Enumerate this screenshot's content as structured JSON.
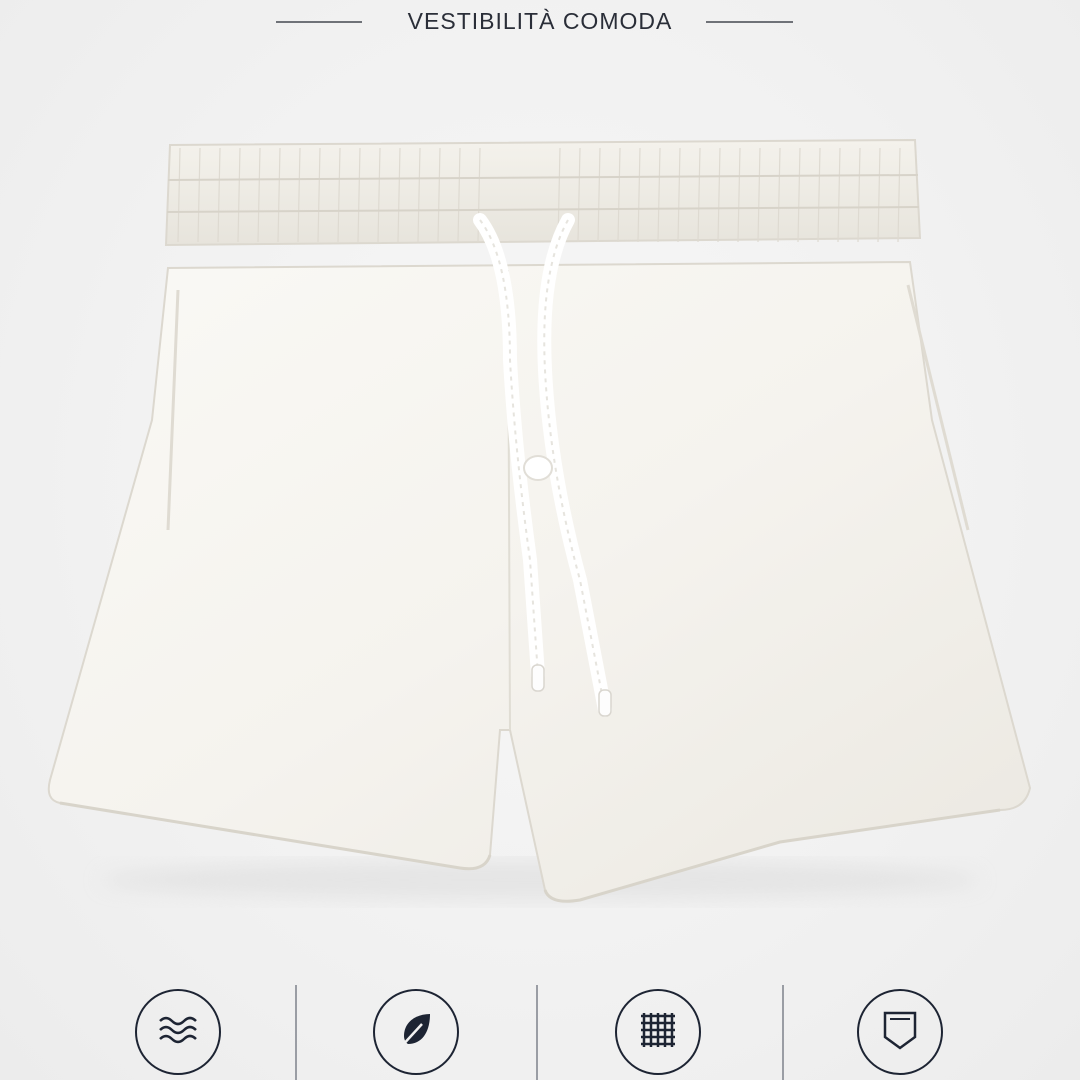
{
  "header": {
    "title": "VESTIBILITÀ COMODA"
  },
  "product": {
    "name": "white-swim-shorts",
    "color": "#f7f5f0"
  },
  "features": [
    {
      "icon": "waves-icon"
    },
    {
      "icon": "leaf-icon"
    },
    {
      "icon": "mesh-grid-icon"
    },
    {
      "icon": "pocket-icon"
    }
  ],
  "colors": {
    "background": "#f2f2f2",
    "text": "#2a2e38",
    "icon_stroke": "#1d2433"
  }
}
